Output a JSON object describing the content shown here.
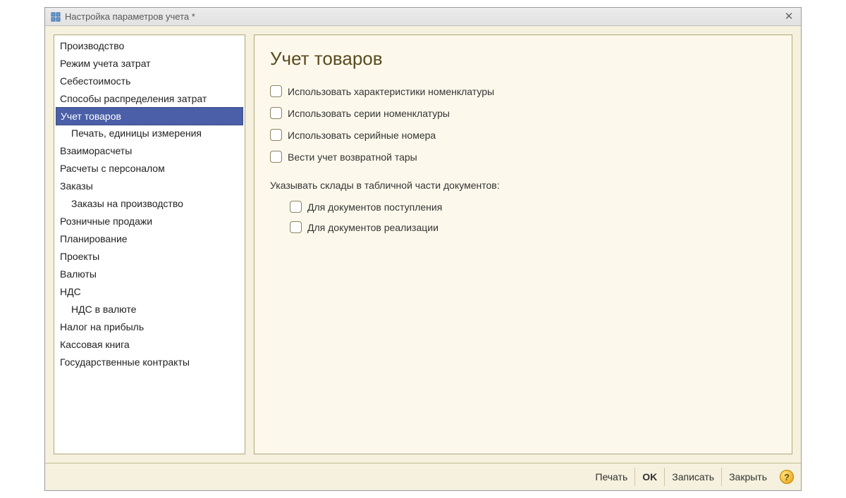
{
  "title": "Настройка параметров учета *",
  "sidebar": {
    "items": [
      {
        "label": "Производство",
        "indent": false,
        "selected": false
      },
      {
        "label": "Режим учета затрат",
        "indent": false,
        "selected": false
      },
      {
        "label": "Себестоимость",
        "indent": false,
        "selected": false
      },
      {
        "label": "Способы распределения затрат",
        "indent": false,
        "selected": false
      },
      {
        "label": "Учет товаров",
        "indent": false,
        "selected": true
      },
      {
        "label": "Печать, единицы измерения",
        "indent": true,
        "selected": false
      },
      {
        "label": "Взаиморасчеты",
        "indent": false,
        "selected": false
      },
      {
        "label": "Расчеты с персоналом",
        "indent": false,
        "selected": false
      },
      {
        "label": "Заказы",
        "indent": false,
        "selected": false
      },
      {
        "label": "Заказы на производство",
        "indent": true,
        "selected": false
      },
      {
        "label": "Розничные продажи",
        "indent": false,
        "selected": false
      },
      {
        "label": "Планирование",
        "indent": false,
        "selected": false
      },
      {
        "label": "Проекты",
        "indent": false,
        "selected": false
      },
      {
        "label": "Валюты",
        "indent": false,
        "selected": false
      },
      {
        "label": "НДС",
        "indent": false,
        "selected": false
      },
      {
        "label": "НДС в валюте",
        "indent": true,
        "selected": false
      },
      {
        "label": "Налог на прибыль",
        "indent": false,
        "selected": false
      },
      {
        "label": "Кассовая книга",
        "indent": false,
        "selected": false
      },
      {
        "label": "Государственные контракты",
        "indent": false,
        "selected": false
      }
    ]
  },
  "content": {
    "heading": "Учет товаров",
    "checks": [
      {
        "label": "Использовать характеристики номенклатуры"
      },
      {
        "label": "Использовать серии номенклатуры"
      },
      {
        "label": "Использовать серийные номера"
      },
      {
        "label": "Вести учет возвратной тары"
      }
    ],
    "section_label": "Указывать склады в табличной части документов:",
    "sub_checks": [
      {
        "label": "Для документов поступления"
      },
      {
        "label": "Для документов реализации"
      }
    ]
  },
  "footer": {
    "print": "Печать",
    "ok": "OK",
    "save": "Записать",
    "close": "Закрыть",
    "help": "?"
  }
}
